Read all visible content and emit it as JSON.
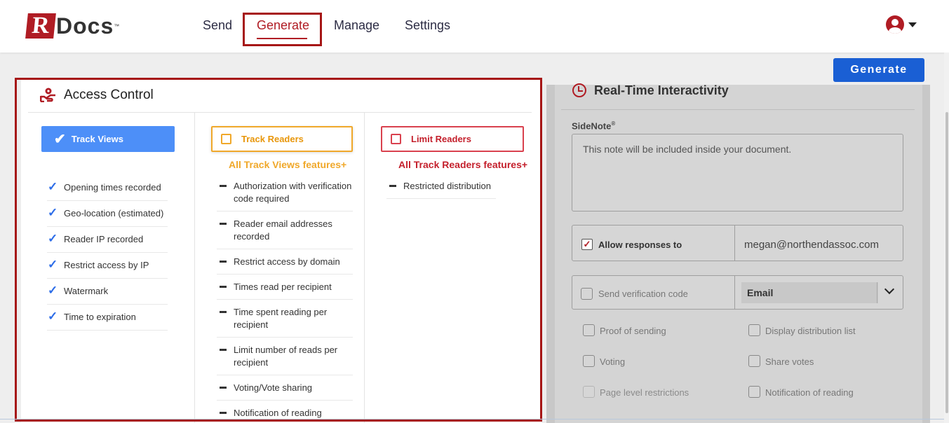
{
  "app": {
    "logo_letter": "R",
    "logo_text": "Docs",
    "logo_tm": "™"
  },
  "nav": {
    "items": [
      "Send",
      "Generate",
      "Manage",
      "Settings"
    ],
    "active": "Generate"
  },
  "toolbar": {
    "generate_label": "Generate"
  },
  "access_control": {
    "title": "Access Control",
    "track_views": {
      "label": "Track Views",
      "features": [
        "Opening times recorded",
        "Geo-location (estimated)",
        "Reader IP recorded",
        "Restrict access by IP",
        "Watermark",
        "Time to expiration"
      ]
    },
    "track_readers": {
      "label": "Track Readers",
      "includes": "All Track Views features+",
      "features": [
        "Authorization with verification code required",
        "Reader email addresses recorded",
        "Restrict access by domain",
        "Times read per recipient",
        "Time spent reading per recipient",
        "Limit number of reads per recipient",
        "Voting/Vote sharing",
        "Notification of reading"
      ]
    },
    "limit_readers": {
      "label": "Limit Readers",
      "includes": "All Track Readers features+",
      "features": [
        "Restricted distribution"
      ]
    }
  },
  "realtime": {
    "title": "Real-Time Interactivity",
    "sidenote_label": "SideNote",
    "sidenote_reg": "®",
    "sidenote_placeholder": "This note will be included inside your document.",
    "allow_responses_label": "Allow responses to",
    "allow_responses_email": "megan@northendassoc.com",
    "send_verification_label": "Send verification code",
    "verification_method": "Email",
    "options": {
      "proof_of_sending": "Proof of sending",
      "display_distribution_list": "Display distribution list",
      "voting": "Voting",
      "share_votes": "Share votes",
      "page_level_restrictions": "Page level restrictions",
      "notification_of_reading": "Notification of reading"
    }
  },
  "colors": {
    "brand_red": "#b01c24",
    "primary_blue": "#1a5fd4",
    "track_views_blue": "#4d8ff8",
    "track_readers_orange": "#f0a82a",
    "limit_readers_red": "#d9414e"
  }
}
